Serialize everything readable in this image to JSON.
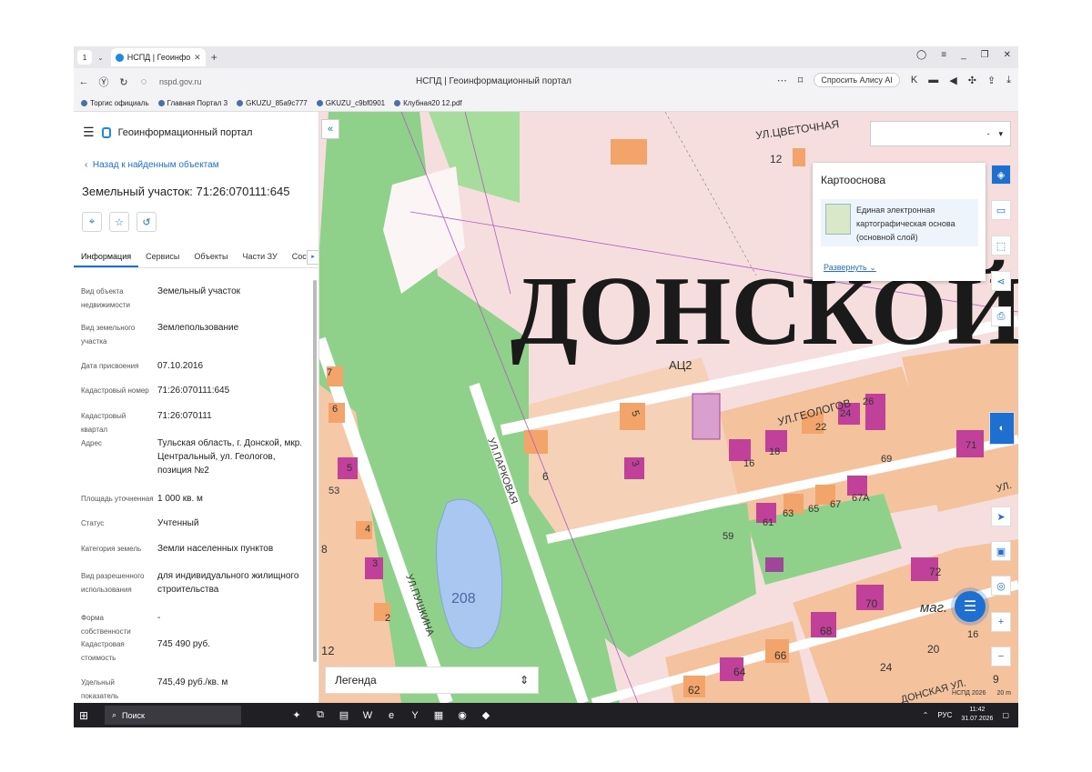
{
  "browser": {
    "tab_count": "1",
    "tab_title": "НСПД | Геоинформацио",
    "url": "nspd.gov.ru",
    "page_title": "НСПД | Геоинформационный портал",
    "alice_label": "Спросить Алису AI",
    "bookmarks": [
      "Торгис официаль",
      "Главная Портал 3",
      "GKUZU_85a9c777",
      "GKUZU_c9bf0901",
      "Клубная20 12.pdf"
    ]
  },
  "panel": {
    "portal_name": "Геоинформационный портал",
    "back_label": "Назад к найденным объектам",
    "title": "Земельный участок: 71:26:070111:645",
    "tabs": [
      "Информация",
      "Сервисы",
      "Объекты",
      "Части ЗУ",
      "Состав"
    ],
    "properties": [
      {
        "key": "Вид объекта недвижимости",
        "value": "Земельный участок"
      },
      {
        "key": "Вид земельного участка",
        "value": "Землепользование"
      },
      {
        "key": "Дата присвоения",
        "value": "07.10.2016"
      },
      {
        "key": "Кадастровый номер",
        "value": "71:26:070111:645"
      },
      {
        "key": "Кадастровый квартал",
        "value": "71:26:070111"
      },
      {
        "key": "Адрес",
        "value": "Тульская область, г. Донской, мкр. Центральный, ул. Геологов, позиция №2"
      },
      {
        "key": "Площадь уточненная",
        "value": "1 000 кв. м"
      },
      {
        "key": "Статус",
        "value": "Учтенный"
      },
      {
        "key": "Категория земель",
        "value": "Земли населенных пунктов"
      },
      {
        "key": "Вид разрешенного использования",
        "value": "для индивидуального жилищного строительства"
      },
      {
        "key": "Форма собственности",
        "value": "-"
      },
      {
        "key": "Кадастровая стоимость",
        "value": "745 490 руб."
      },
      {
        "key": "Удельный показатель кадастровой",
        "value": "745,49 руб./кв. м"
      }
    ]
  },
  "map": {
    "top_select_value": "-",
    "basemap_title": "Картооснова",
    "basemap_item": "Единая электронная картографическая основа (основной слой)",
    "expand_label": "Развернуть",
    "legend_label": "Легенда",
    "scale_left": "НСПД 2026",
    "scale_right": "20 m",
    "labels": {
      "city": "ДОНСКОЙ",
      "zone": "АЦ2",
      "street_tsvetochnaya": "УЛ.ЦВЕТОЧНАЯ",
      "street_geologov": "УЛ.ГЕОЛОГОВ",
      "street_parkovaya": "УЛ.ПАРКОВАЯ",
      "street_pushkina": "УЛ.ПУШКИНА",
      "street_donskaya": "ДОНСКАЯ УЛ.",
      "street_ul": "УЛ.",
      "pond": "208",
      "shop": "маг.",
      "houses": [
        "12",
        "5",
        "6",
        "3",
        "16",
        "18",
        "22",
        "24",
        "26",
        "69",
        "71",
        "61",
        "63",
        "65",
        "67",
        "67А",
        "59",
        "72",
        "70",
        "68",
        "66",
        "64",
        "62",
        "20",
        "24",
        "16",
        "9",
        "8",
        "4",
        "3",
        "2",
        "5",
        "53",
        "6",
        "7",
        "12"
      ]
    }
  },
  "taskbar": {
    "search_label": "Поиск",
    "lang": "РУС",
    "time": "11:42",
    "date": "31.07.2026"
  },
  "colors": {
    "accent": "#1e6fd0",
    "park": "#8fd18a",
    "building": "#f2a46b",
    "building_dark": "#c0409a",
    "parcel_pink": "#f6dede",
    "water": "#a9c7f0"
  }
}
